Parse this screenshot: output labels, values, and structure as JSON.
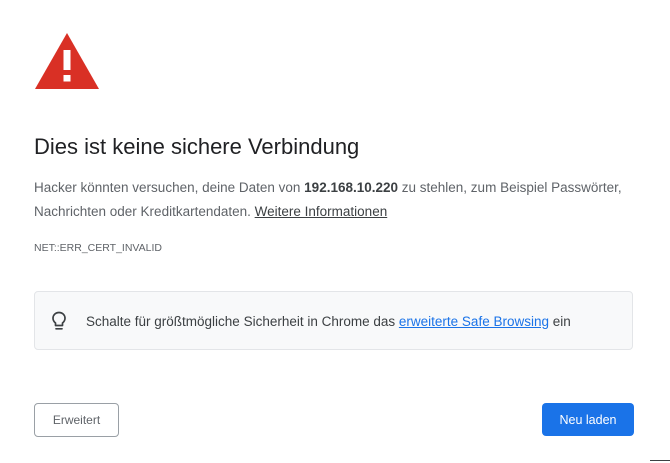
{
  "title": "Dies ist keine sichere Verbindung",
  "description": {
    "before": "Hacker könnten versuchen, deine Daten von ",
    "host": "192.168.10.220",
    "after": " zu stehlen, zum Beispiel Passwörter, Nachrichten oder Kreditkartendaten. ",
    "learn_more": "Weitere Informationen"
  },
  "error_code": "NET::ERR_CERT_INVALID",
  "safe_browsing": {
    "before": "Schalte für größtmögliche Sicherheit in Chrome das ",
    "link": "erweiterte Safe Browsing",
    "after": " ein"
  },
  "buttons": {
    "advanced": "Erweitert",
    "reload": "Neu laden"
  },
  "icons": {
    "warning": "warning-triangle-icon",
    "bulb": "lightbulb-icon"
  },
  "colors": {
    "warning": "#d93025",
    "link": "#1a73e8",
    "primary_button": "#1a73e8"
  }
}
